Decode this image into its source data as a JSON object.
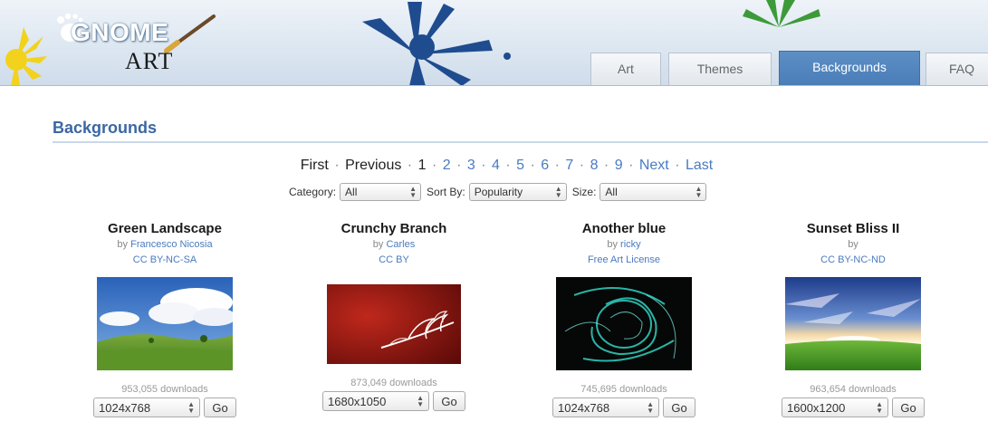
{
  "logo": {
    "wordmark": "GNOME",
    "subtitle": "ART"
  },
  "tabs": [
    {
      "label": "Art",
      "active": false
    },
    {
      "label": "Themes",
      "active": false
    },
    {
      "label": "Backgrounds",
      "active": true
    },
    {
      "label": "FAQ",
      "active": false
    }
  ],
  "section_title": "Backgrounds",
  "pager": {
    "first": "First",
    "previous": "Previous",
    "current": "1",
    "pages": [
      "2",
      "3",
      "4",
      "5",
      "6",
      "7",
      "8",
      "9"
    ],
    "next": "Next",
    "last": "Last",
    "separator": "·"
  },
  "filters": {
    "category_label": "Category:",
    "category_value": "All",
    "sort_label": "Sort By:",
    "sort_value": "Popularity",
    "size_label": "Size:",
    "size_value": "All"
  },
  "by_prefix": "by",
  "go_label": "Go",
  "items": [
    {
      "title": "Green Landscape",
      "author": "Francesco Nicosia",
      "license": "CC BY-NC-SA",
      "downloads": "953,055 downloads",
      "resolution": "1024x768"
    },
    {
      "title": "Crunchy Branch",
      "author": "Carles",
      "license": "CC BY",
      "downloads": "873,049 downloads",
      "resolution": "1680x1050"
    },
    {
      "title": "Another blue",
      "author": "ricky",
      "license": "Free Art License",
      "downloads": "745,695 downloads",
      "resolution": "1024x768"
    },
    {
      "title": "Sunset Bliss II",
      "author": "",
      "license": "CC BY-NC-ND",
      "downloads": "963,654 downloads",
      "resolution": "1600x1200"
    }
  ],
  "colors": {
    "link": "#4a7bc0",
    "heading": "#3b67a3",
    "tab_active": "#4a7db8"
  }
}
